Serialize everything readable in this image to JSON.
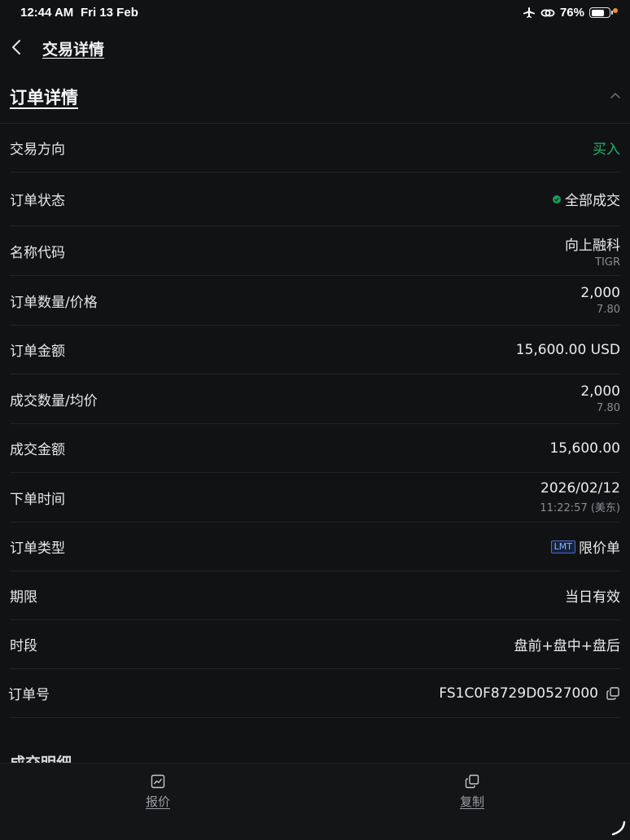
{
  "status_bar": {
    "time": "12:44 AM",
    "date": "Fri 13 Feb",
    "battery": "76%",
    "battery_level": 0.76
  },
  "nav": {
    "title": "交易详情"
  },
  "section": {
    "title": "订单详情"
  },
  "rows": {
    "direction": {
      "label": "交易方向",
      "value": "买入"
    },
    "status": {
      "label": "订单状态",
      "value": "全部成交"
    },
    "name": {
      "label": "名称代码",
      "value": "向上融科",
      "sub": "TIGR"
    },
    "qty_price": {
      "label": "订单数量/价格",
      "value": "2,000",
      "sub": "7.80"
    },
    "amount": {
      "label": "订单金额",
      "value": "15,600.00 USD"
    },
    "fill_qty": {
      "label": "成交数量/均价",
      "value": "2,000",
      "sub": "7.80"
    },
    "fill_amount": {
      "label": "成交金额",
      "value": "15,600.00"
    },
    "time": {
      "label": "下单时间",
      "value": "2026/02/12",
      "sub": "11:22:57 (美东)"
    },
    "type": {
      "label": "订单类型",
      "badge": "LMT",
      "value": "限价单"
    },
    "validity": {
      "label": "期限",
      "value": "当日有效"
    },
    "session": {
      "label": "时段",
      "value": "盘前+盘中+盘后"
    },
    "order_id": {
      "label": "订单号",
      "value": "FS1C0F8729D0527000"
    }
  },
  "partial_heading": "成交明细",
  "bottom_tabs": {
    "quote": "报价",
    "copy": "复制"
  },
  "colors": {
    "background": "#111214",
    "buy": "#22b06b",
    "status_ok": "#1f9d5c"
  }
}
